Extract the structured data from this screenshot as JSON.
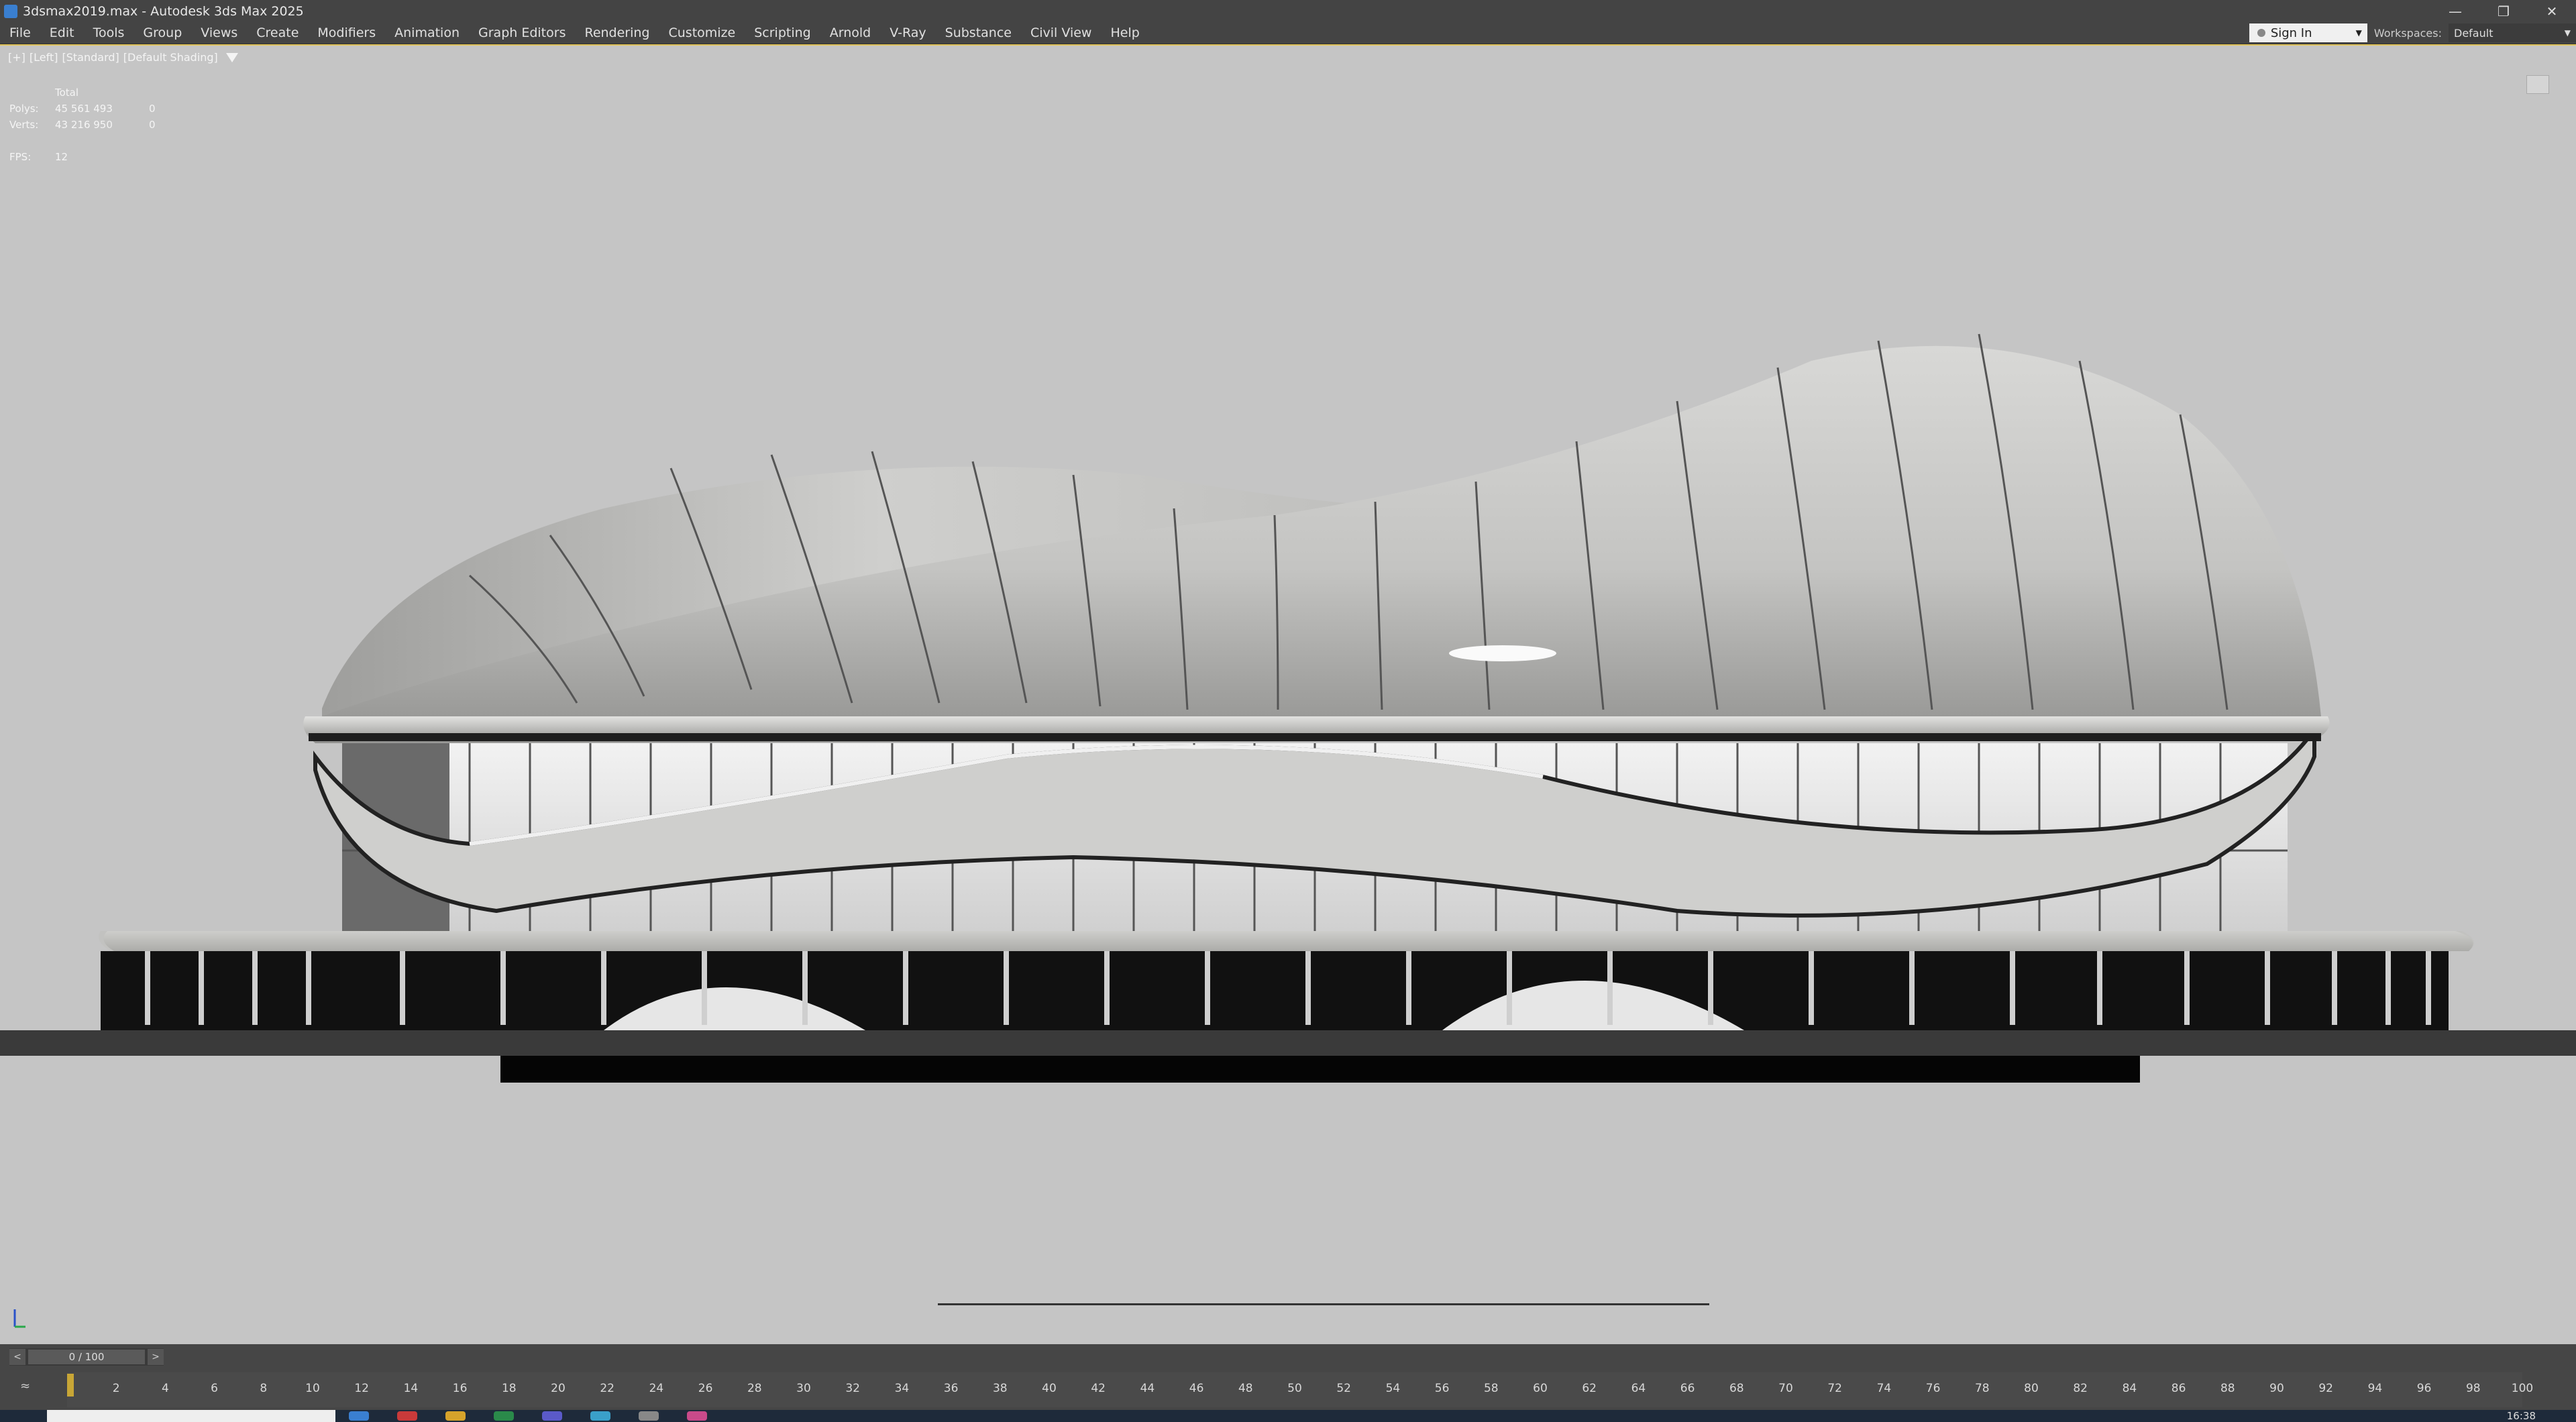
{
  "window": {
    "title": "3dsmax2019.max - Autodesk 3ds Max 2025",
    "controls": [
      "minimize-icon",
      "restore-icon",
      "close-icon"
    ]
  },
  "menu": [
    "File",
    "Edit",
    "Tools",
    "Group",
    "Views",
    "Create",
    "Modifiers",
    "Animation",
    "Graph Editors",
    "Rendering",
    "Customize",
    "Scripting",
    "Arnold",
    "V-Ray",
    "Substance",
    "Civil View",
    "Help"
  ],
  "account": {
    "sign_in": "Sign In",
    "workspaces_label": "Workspaces:",
    "workspace_value": "Default"
  },
  "viewport": {
    "labels": [
      "[+]",
      "[Left]",
      "[Standard]",
      "[Default Shading]"
    ],
    "stats": {
      "header": "Total",
      "polys_label": "Polys:",
      "polys_value": "45 561 493",
      "polys_sel": "0",
      "verts_label": "Verts:",
      "verts_value": "43 216 950",
      "verts_sel": "0",
      "fps_label": "FPS:",
      "fps_value": "12"
    },
    "colors": {
      "background": "#c5c5c5",
      "active_border": "#e0c35a"
    }
  },
  "timeline": {
    "frame_display": "0 / 100",
    "prev": "<",
    "next": ">",
    "ticks": [
      "2",
      "4",
      "6",
      "8",
      "10",
      "12",
      "14",
      "16",
      "18",
      "20",
      "22",
      "24",
      "26",
      "28",
      "30",
      "32",
      "34",
      "36",
      "38",
      "40",
      "42",
      "44",
      "46",
      "48",
      "50",
      "52",
      "54",
      "56",
      "58",
      "60",
      "62",
      "64",
      "66",
      "68",
      "70",
      "72",
      "74",
      "76",
      "78",
      "80",
      "82",
      "84",
      "86",
      "88",
      "90",
      "92",
      "94",
      "96",
      "98",
      "100"
    ]
  },
  "taskbar": {
    "clock": "16:38"
  }
}
